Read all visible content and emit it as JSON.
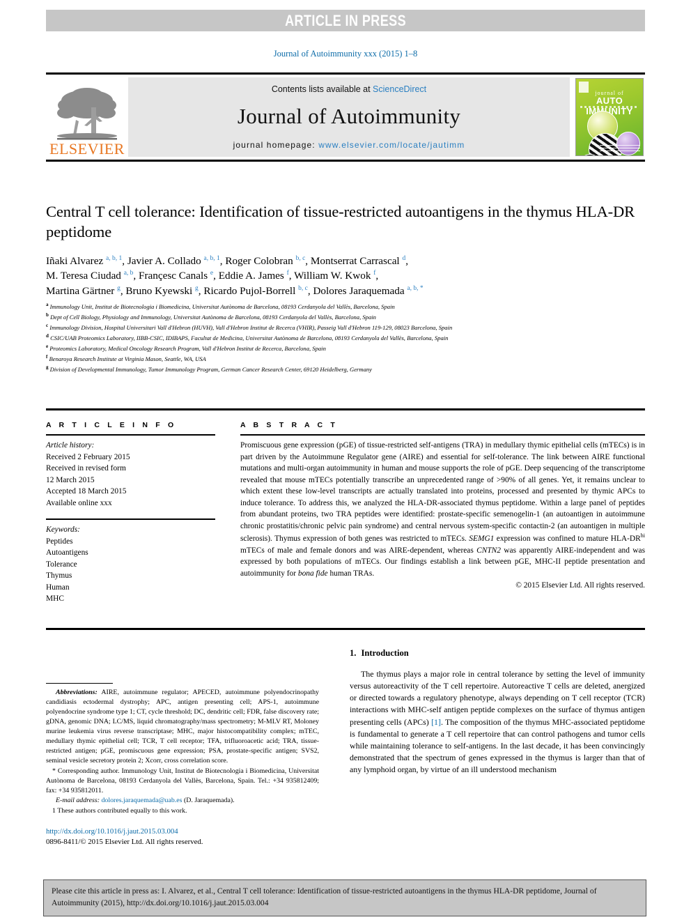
{
  "banner": {
    "label": "ARTICLE IN PRESS"
  },
  "journal_ref": "Journal of Autoimmunity xxx (2015) 1–8",
  "masthead": {
    "publisher": "ELSEVIER",
    "contents_prefix": "Contents lists available at ",
    "contents_link": "ScienceDirect",
    "journal_title": "Journal of Autoimmunity",
    "homepage_prefix": "journal homepage: ",
    "homepage_url": "www.elsevier.com/locate/jautimm",
    "cover": {
      "line1": "journal of",
      "line2": "AUTO IMMUNITY"
    }
  },
  "article": {
    "title": "Central T cell tolerance: Identification of tissue-restricted autoantigens in the thymus HLA-DR peptidome",
    "authors_lines": [
      "Iñaki Alvarez a, b, 1, Javier A. Collado a, b, 1, Roger Colobran b, c, Montserrat Carrascal d,",
      "M. Teresa Ciudad a, b, Françesc Canals e, Eddie A. James f, William W. Kwok f,",
      "Martina Gärtner g, Bruno Kyewski g, Ricardo Pujol-Borrell b, c, Dolores Jaraquemada a, b, *"
    ],
    "affiliations": [
      {
        "marker": "a",
        "text": "Immunology Unit, Institut de Biotecnologia i Biomedicina, Universitat Autònoma de Barcelona, 08193 Cerdanyola del Vallès, Barcelona, Spain"
      },
      {
        "marker": "b",
        "text": "Dept of Cell Biology, Physiology and Immunology, Universitat Autònoma de Barcelona, 08193 Cerdanyola del Vallès, Barcelona, Spain"
      },
      {
        "marker": "c",
        "text": "Immunology Division, Hospital Universitari Vall d'Hebron (HUVH), Vall d'Hebron Institut de Recerca (VHIR), Passeig Vall d'Hebron 119-129, 08023 Barcelona, Spain"
      },
      {
        "marker": "d",
        "text": "CSIC/UAB Proteomics Laboratory, IIBB-CSIC, IDIBAPS, Facultat de Medicina, Universitat Autònoma de Barcelona, 08193 Cerdanyola del Vallès, Barcelona, Spain"
      },
      {
        "marker": "e",
        "text": "Proteomics Laboratory, Medical Oncology Research Program, Vall d'Hebron Institut de Recerca, Barcelona, Spain"
      },
      {
        "marker": "f",
        "text": "Benaroya Research Institute at Virginia Mason, Seattle, WA, USA"
      },
      {
        "marker": "g",
        "text": "Division of Developmental Immunology, Tumor Immunology Program, German Cancer Research Center, 69120 Heidelberg, Germany"
      }
    ]
  },
  "article_info": {
    "heading": "A R T I C L E  I N F O",
    "history_label": "Article history:",
    "history": [
      "Received 2 February 2015",
      "Received in revised form",
      "12 March 2015",
      "Accepted 18 March 2015",
      "Available online xxx"
    ],
    "keywords_label": "Keywords:",
    "keywords": [
      "Peptides",
      "Autoantigens",
      "Tolerance",
      "Thymus",
      "Human",
      "MHC"
    ]
  },
  "abstract": {
    "heading": "A B S T R A C T",
    "part1": "Promiscuous gene expression (pGE) of tissue-restricted self-antigens (TRA) in medullary thymic epithelial cells (mTECs) is in part driven by the Autoimmune Regulator gene (AIRE) and essential for self-tolerance. The link between AIRE functional mutations and multi-organ autoimmunity in human and mouse supports the role of pGE. Deep sequencing of the transcriptome revealed that mouse mTECs potentially transcribe an unprecedented range of >90% of all genes. Yet, it remains unclear to which extent these low-level transcripts are actually translated into proteins, processed and presented by thymic APCs to induce tolerance. To address this, we analyzed the HLA-DR-associated thymus peptidome. Within a large panel of peptides from abundant proteins, two TRA peptides were identified: prostate-specific semenogelin-1 (an autoantigen in autoimmune chronic prostatitis/chronic pelvic pain syndrome) and central nervous system-specific contactin-2 (an autoantigen in multiple sclerosis). Thymus expression of both genes was restricted to mTECs. ",
    "semg1": "SEMG1",
    "part2": " expression was confined to mature HLA-DR",
    "sup_hi": "hi",
    "part3": " mTECs of male and female donors and was AIRE-dependent, whereas ",
    "cntn2": "CNTN2",
    "part4": " was apparently AIRE-independent and was expressed by both populations of mTECs. Our findings establish a link between pGE, MHC-II peptide presentation and autoimmunity for ",
    "bona_fide": "bona fide",
    "part5": " human TRAs.",
    "copyright": "© 2015 Elsevier Ltd. All rights reserved."
  },
  "footnotes": {
    "abbrev_label": "Abbreviations:",
    "abbrev_text": " AIRE, autoimmune regulator; APECED, autoimmune polyendocrinopathy candidiasis ectodermal dystrophy; APC, antigen presenting cell; APS-1, autoimmune polyendocrine syndrome type 1; CT, cycle threshold; DC, dendritic cell; FDR, false discovery rate; gDNA, genomic DNA; LC/MS, liquid chromatography/mass spectrometry; M-MLV RT, Moloney murine leukemia virus reverse transcriptase; MHC, major histocompatibility complex; mTEC, medullary thymic epithelial cell; TCR, T cell receptor; TFA, trifluoroacetic acid; TRA, tissue-restricted antigen; pGE, promiscuous gene expression; PSA, prostate-specific antigen; SVS2, seminal vesicle secretory protein 2; Xcorr, cross correlation score.",
    "corresponding": "* Corresponding author. Immunology Unit, Institut de Biotecnologia i Biomedicina, Universitat Autònoma de Barcelona, 08193 Cerdanyola del Vallès, Barcelona, Spain. Tel.: +34 935812409; fax: +34 935812011.",
    "email_label": "E-mail address:",
    "email": "dolores.jaraquemada@uab.es",
    "email_suffix": " (D. Jaraquemada).",
    "equal_contrib": "1  These authors contributed equally to this work.",
    "doi": "http://dx.doi.org/10.1016/j.jaut.2015.03.004",
    "issn": "0896-8411/© 2015 Elsevier Ltd. All rights reserved."
  },
  "introduction": {
    "heading_number": "1.",
    "heading_text": "Introduction",
    "para_a": "The thymus plays a major role in central tolerance by setting the level of immunity versus autoreactivity of the T cell repertoire. Autoreactive T cells are deleted, anergized or directed towards a regulatory phenotype, always depending on T cell receptor (TCR) interactions with MHC-self antigen peptide complexes on the surface of thymus antigen presenting cells (APCs) ",
    "ref1": "[1]",
    "para_b": ". The composition of the thymus MHC-associated peptidome is fundamental to generate a T cell repertoire that can control pathogens and tumor cells while maintaining tolerance to self-antigens. In the last decade, it has been convincingly demonstrated that the spectrum of genes expressed in the thymus is larger than that of any lymphoid organ, by virtue of an ill understood mechanism"
  },
  "cite_box": {
    "text": "Please cite this article in press as: I. Alvarez, et al., Central T cell tolerance: Identification of tissue-restricted autoantigens in the thymus HLA-DR peptidome, Journal of Autoimmunity (2015), http://dx.doi.org/10.1016/j.jaut.2015.03.004"
  },
  "colors": {
    "link": "#0b6ba8",
    "banner_bg": "#c6c6c6",
    "elsevier_orange": "#e87722"
  }
}
